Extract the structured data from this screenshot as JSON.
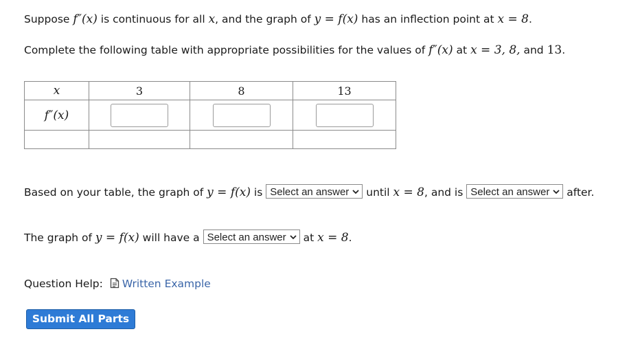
{
  "question": {
    "line1": {
      "t1": "Suppose ",
      "m1": "f″(x)",
      "t2": " is continuous for all ",
      "m2": "x",
      "t3": ", and the graph of ",
      "m3": "y = f(x)",
      "t4": " has an inflection point at ",
      "m4": "x = 8",
      "t5": "."
    },
    "line2": {
      "t1": "Complete the following table with appropriate possibilities for the values of ",
      "m1": "f″(x)",
      "t2": " at ",
      "m2": "x = 3, 8,",
      "t3": " and ",
      "m3": "13",
      "t4": "."
    }
  },
  "table": {
    "header_var": "x",
    "header_values": [
      "3",
      "8",
      "13"
    ],
    "row_label": "f″(x)",
    "inputs": [
      "",
      "",
      ""
    ]
  },
  "para1": {
    "t1": "Based on your table, the graph of ",
    "m1": "y = f(x)",
    "t2": " is ",
    "select1": "Select an answer",
    "t3": " until ",
    "m2": "x = 8",
    "t4": ", and is ",
    "select2": "Select an answer",
    "t5": " after."
  },
  "para2": {
    "t1": "The graph of ",
    "m1": "y = f(x)",
    "t2": " will have a ",
    "select1": "Select an answer",
    "t3": " at ",
    "m2": "x = 8",
    "t4": "."
  },
  "help": {
    "label": "Question Help:",
    "icon": "document-icon",
    "link": "Written Example"
  },
  "submit_label": "Submit All Parts",
  "colors": {
    "submit_bg": "#2e7bd6",
    "link": "#3a65a8"
  }
}
